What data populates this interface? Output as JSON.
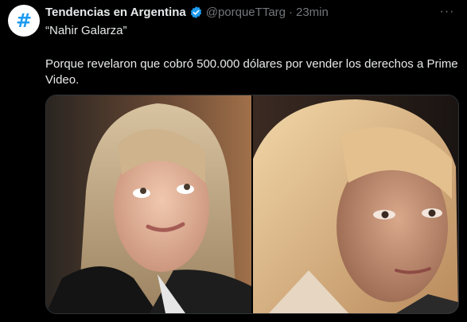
{
  "tweet": {
    "avatar_glyph": "#",
    "display_name": "Tendencias en Argentina",
    "handle": "@porqueTTarg",
    "separator": "·",
    "time": "23min",
    "more_label": "···",
    "title_line": "“Nahir Galarza”",
    "body": "Porque revelaron que cobró 500.000 dólares por vender los derechos a Prime Video."
  },
  "media": {
    "photos": [
      {
        "subject": "young-woman-blonde-hair-photo"
      },
      {
        "subject": "actress-blonde-hair-photo"
      }
    ]
  },
  "colors": {
    "background": "#000000",
    "text": "#e7e9ea",
    "muted": "#71767b",
    "accent": "#1d9bf0"
  }
}
